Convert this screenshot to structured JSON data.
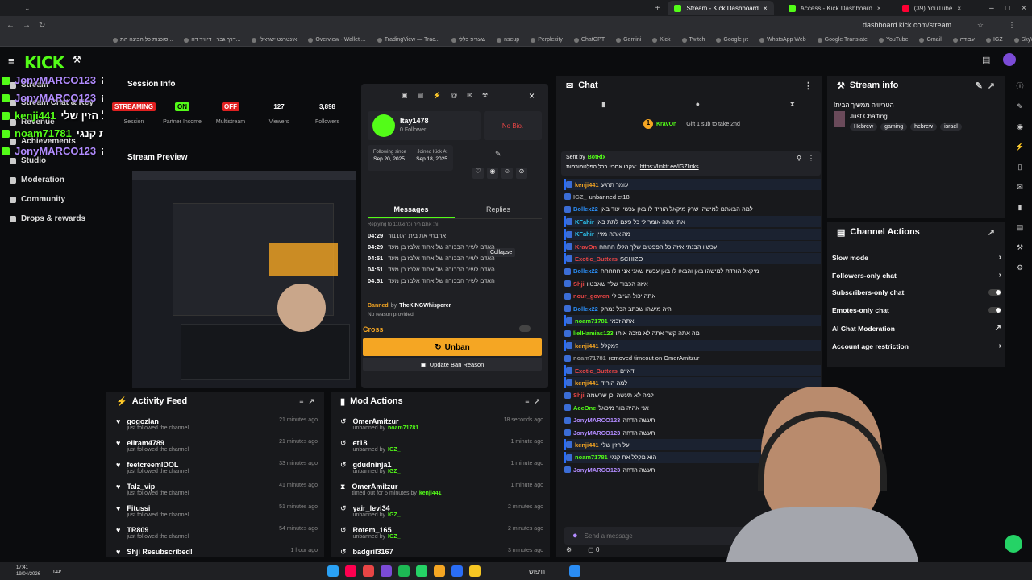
{
  "browser": {
    "tabs": [
      {
        "label": "Stream - Kick Dashboard",
        "active": true
      },
      {
        "label": "Access - Kick Dashboard",
        "active": false
      },
      {
        "label": "(39) YouTube",
        "active": false
      }
    ],
    "url": "dashboard.kick.com/stream",
    "bookmarks": [
      "סוכנות כל הבינה הת...",
      "דרך גבר - דיוויד דה...",
      "אינטרנט ישראלי",
      "Overview - Wallet ...",
      "TradingView — Trac...",
      "שעריפ כללי",
      "nseup",
      "Perplexity",
      "ChatGPT",
      "Gemini",
      "Kick",
      "Twitch",
      "Google אן",
      "WhatsApp Web",
      "Google Translate",
      "YouTube",
      "Gmail",
      "עבודה",
      "IGZ",
      "SkyWay Tours",
      "סרטונים ורעיונות",
      "משימות"
    ]
  },
  "kick": {
    "logo": "KICK"
  },
  "sidebar": {
    "items": [
      "Stream",
      "Stream Chat & Key",
      "Revenue",
      "Achievements",
      "Studio",
      "Moderation",
      "Community",
      "Drops & rewards"
    ]
  },
  "chat_overlay": [
    {
      "user": "JonyMARCO123",
      "text": "תעשה הדחה"
    },
    {
      "user": "JonyMARCO123",
      "text": "תעשה הדחה"
    },
    {
      "user": "kenji441",
      "text": "על הזין שלי :"
    },
    {
      "user": "noam71781",
      "text": "הוא מקלל את קנגי"
    },
    {
      "user": "JonyMARCO123",
      "text": "תעשה הדחה"
    }
  ],
  "session": {
    "title": "Session Info",
    "stats": [
      {
        "label": "Session",
        "value": "STREAMING"
      },
      {
        "label": "Partner Income",
        "value": "ON"
      },
      {
        "label": "Multistream",
        "value": "OFF"
      },
      {
        "label": "Viewers",
        "value": "127"
      },
      {
        "label": "Followers",
        "value": "3,898"
      }
    ]
  },
  "preview": {
    "title": "Stream Preview"
  },
  "user_card": {
    "username": "Itay1478",
    "followers": "0 Follower",
    "bio": "No Bio.",
    "following_since_label": "Following since",
    "following_since": "Sep 20, 2025",
    "joined_label": "Joined Kick At",
    "joined": "Sep 18, 2025",
    "tabs": [
      "Messages",
      "Replies"
    ],
    "reply_hint": "Replying to 110ור: אתם היה וכהוא",
    "messages": [
      {
        "time": "04:29",
        "text": "אהבתי את בית ה110ור"
      },
      {
        "time": "04:29",
        "text": "האדם לשיר הבכורה של אחוד אלבז בן מעד"
      },
      {
        "time": "04:51",
        "text": "האדם לשיר הבכורה של אחוד אלבז בן מעד"
      },
      {
        "time": "04:51",
        "text": "האדם לשיר הבכורה של אחוד אלבז בן מעד"
      },
      {
        "time": "04:51",
        "text": "האדם לשיר הבכורה של אחוד אלבז בן מעד"
      }
    ],
    "tooltip": "Collapse",
    "banned_label": "Banned",
    "banned_by_prefix": "by",
    "banned_by": "TheKINGWhisperer",
    "no_reason": "No reason provided",
    "cross_label": "Cross",
    "unban_label": "Unban",
    "update_label": "Update Ban Reason"
  },
  "activity": {
    "title": "Activity Feed",
    "rows": [
      {
        "name": "gogozlan",
        "sub": "just followed the channel",
        "time": "21 minutes ago"
      },
      {
        "name": "eliram4789",
        "sub": "just followed the channel",
        "time": "21 minutes ago"
      },
      {
        "name": "feetcreemIDOL",
        "sub": "just followed the channel",
        "time": "33 minutes ago"
      },
      {
        "name": "Talz_vip",
        "sub": "just followed the channel",
        "time": "41 minutes ago"
      },
      {
        "name": "Fitussi",
        "sub": "just followed the channel",
        "time": "51 minutes ago"
      },
      {
        "name": "TR809",
        "sub": "just followed the channel",
        "time": "54 minutes ago"
      },
      {
        "name": "Shji Resubscribed!",
        "sub": "",
        "time": "1 hour ago"
      }
    ]
  },
  "mod_actions": {
    "title": "Mod Actions",
    "rows": [
      {
        "name": "OmerAmitzur",
        "sub": "unbanned by",
        "by": "noam71781",
        "time": "18 seconds ago"
      },
      {
        "name": "et18",
        "sub": "unbanned by",
        "by": "IGZ_",
        "time": "1 minute ago"
      },
      {
        "name": "gdudninja1",
        "sub": "unbanned by",
        "by": "IGZ_",
        "time": "1 minute ago"
      },
      {
        "name": "OmerAmitzur",
        "sub": "timed out for 5 minutes by",
        "by": "kenji441",
        "time": "1 minute ago"
      },
      {
        "name": "yair_levi34",
        "sub": "unbanned by",
        "by": "IGZ_",
        "time": "2 minutes ago"
      },
      {
        "name": "Rotem_165",
        "sub": "unbanned by",
        "by": "IGZ_",
        "time": "2 minutes ago"
      },
      {
        "name": "badgril3167",
        "sub": "",
        "by": "",
        "time": "3 minutes ago"
      }
    ]
  },
  "chat": {
    "title": "Chat",
    "gift_user": "KravOn",
    "gift_count": "1",
    "gift_text": "Gift 1 sub to take 2nd",
    "pinned_by": "Sent by",
    "pinned_user": "BotRix",
    "pinned_text": "עקבו אחריי בכל הפלטפורמות:",
    "pinned_link": "https://linktr.ee/IGZlinks",
    "lines": [
      {
        "user": "kenji441",
        "color": "#f5a623",
        "text": "עומר תרגע",
        "hl": true
      },
      {
        "user": "IGZ_",
        "color": "#999",
        "text": "unbanned et18",
        "hl": false
      },
      {
        "user": "Bollex22",
        "color": "#2a8df5",
        "text": "למה הבאתם למישהו שרק מיקאל הוריד לו באן עכשיו עוד באן",
        "hl": false
      },
      {
        "user": "KFahir",
        "color": "#2ec4f0",
        "text": "אתי אתה אומר לי כל פעם לתת באן",
        "hl": true
      },
      {
        "user": "KFahir",
        "color": "#2ec4f0",
        "text": "מה אתה מזיין",
        "hl": true
      },
      {
        "user": "KravOn",
        "color": "#e84545",
        "text": "עכשיו הבנתי איזה כל הפפטים שלך הללו חחחח",
        "hl": true
      },
      {
        "user": "Exotic_Butters",
        "color": "#e84545",
        "text": "SCHIZO",
        "hl": true
      },
      {
        "user": "Bollex22",
        "color": "#2a8df5",
        "text": "מיקאל הורדת למישהו באן והבאו לו באן עכשיו שאני אני חחחחח",
        "hl": false
      },
      {
        "user": "Shji",
        "color": "#e84545",
        "text": "איזה הכבוד שלך שאבטוו",
        "hl": false
      },
      {
        "user": "nour_gowen",
        "color": "#e84545",
        "text": "אתה יכול הגייב לי",
        "hl": false
      },
      {
        "user": "Bollex22",
        "color": "#2a8df5",
        "text": "היה מישהו שכתב הכל נמחק",
        "hl": false
      },
      {
        "user": "noam71781",
        "color": "#53fc18",
        "text": "אתה זכאי",
        "hl": true
      },
      {
        "user": "lielHamias123",
        "color": "#53fc18",
        "text": "מה אתה קשר אתה לא מזכה אותו",
        "hl": false
      },
      {
        "user": "kenji441",
        "color": "#f5a623",
        "text": "מקלל?",
        "hl": true
      },
      {
        "user": "noam71781",
        "color": "#999",
        "text": "removed timeout on OmerAmitzur",
        "hl": false
      },
      {
        "user": "Exotic_Butters",
        "color": "#e84545",
        "text": "דאיים",
        "hl": true
      },
      {
        "user": "kenji441",
        "color": "#f5a623",
        "text": "למה הוריד",
        "hl": true
      },
      {
        "user": "Shji",
        "color": "#e84545",
        "text": "למה לא תעשה יכן שרשמה",
        "hl": false
      },
      {
        "user": "AceOne",
        "color": "#53fc18",
        "text": "אני אהיה מור מיכאל",
        "hl": false
      },
      {
        "user": "JonyMARCO123",
        "color": "#b28cff",
        "text": "תעשה הדחה",
        "hl": false
      },
      {
        "user": "JonyMARCO123",
        "color": "#b28cff",
        "text": "תעשה הדחה",
        "hl": false
      },
      {
        "user": "kenji441",
        "color": "#f5a623",
        "text": "על הזין שלי",
        "hl": true
      },
      {
        "user": "noam71781",
        "color": "#53fc18",
        "text": "הוא מקלל את קנגי",
        "hl": true
      },
      {
        "user": "JonyMARCO123",
        "color": "#b28cff",
        "text": "תעשה הדחה",
        "hl": false
      }
    ],
    "placeholder": "Send a message",
    "viewers_count": "0"
  },
  "stream_info": {
    "title": "Stream info",
    "stream_title": "!הטריוויה ממשיך הבית",
    "category": "Just Chatting",
    "tags": [
      "Hebrew",
      "gaming",
      "hebrew",
      "israel"
    ]
  },
  "channel_actions": {
    "title": "Channel Actions",
    "rows": [
      {
        "label": "Slow mode",
        "control": "chevron"
      },
      {
        "label": "Followers-only chat",
        "control": "chevron"
      },
      {
        "label": "Subscribers-only chat",
        "control": "toggle"
      },
      {
        "label": "Emotes-only chat",
        "control": "toggle"
      },
      {
        "label": "AI Chat Moderation",
        "control": "link"
      },
      {
        "label": "Account age restriction",
        "control": "chevron"
      }
    ]
  },
  "taskbar": {
    "time": "17:41",
    "date": "19/04/2026",
    "lang": "עבר",
    "search": "חיפוש"
  },
  "colors": {
    "kick_green": "#53fc18",
    "unban_yellow": "#f5a623",
    "panel_bg": "#18191c"
  }
}
